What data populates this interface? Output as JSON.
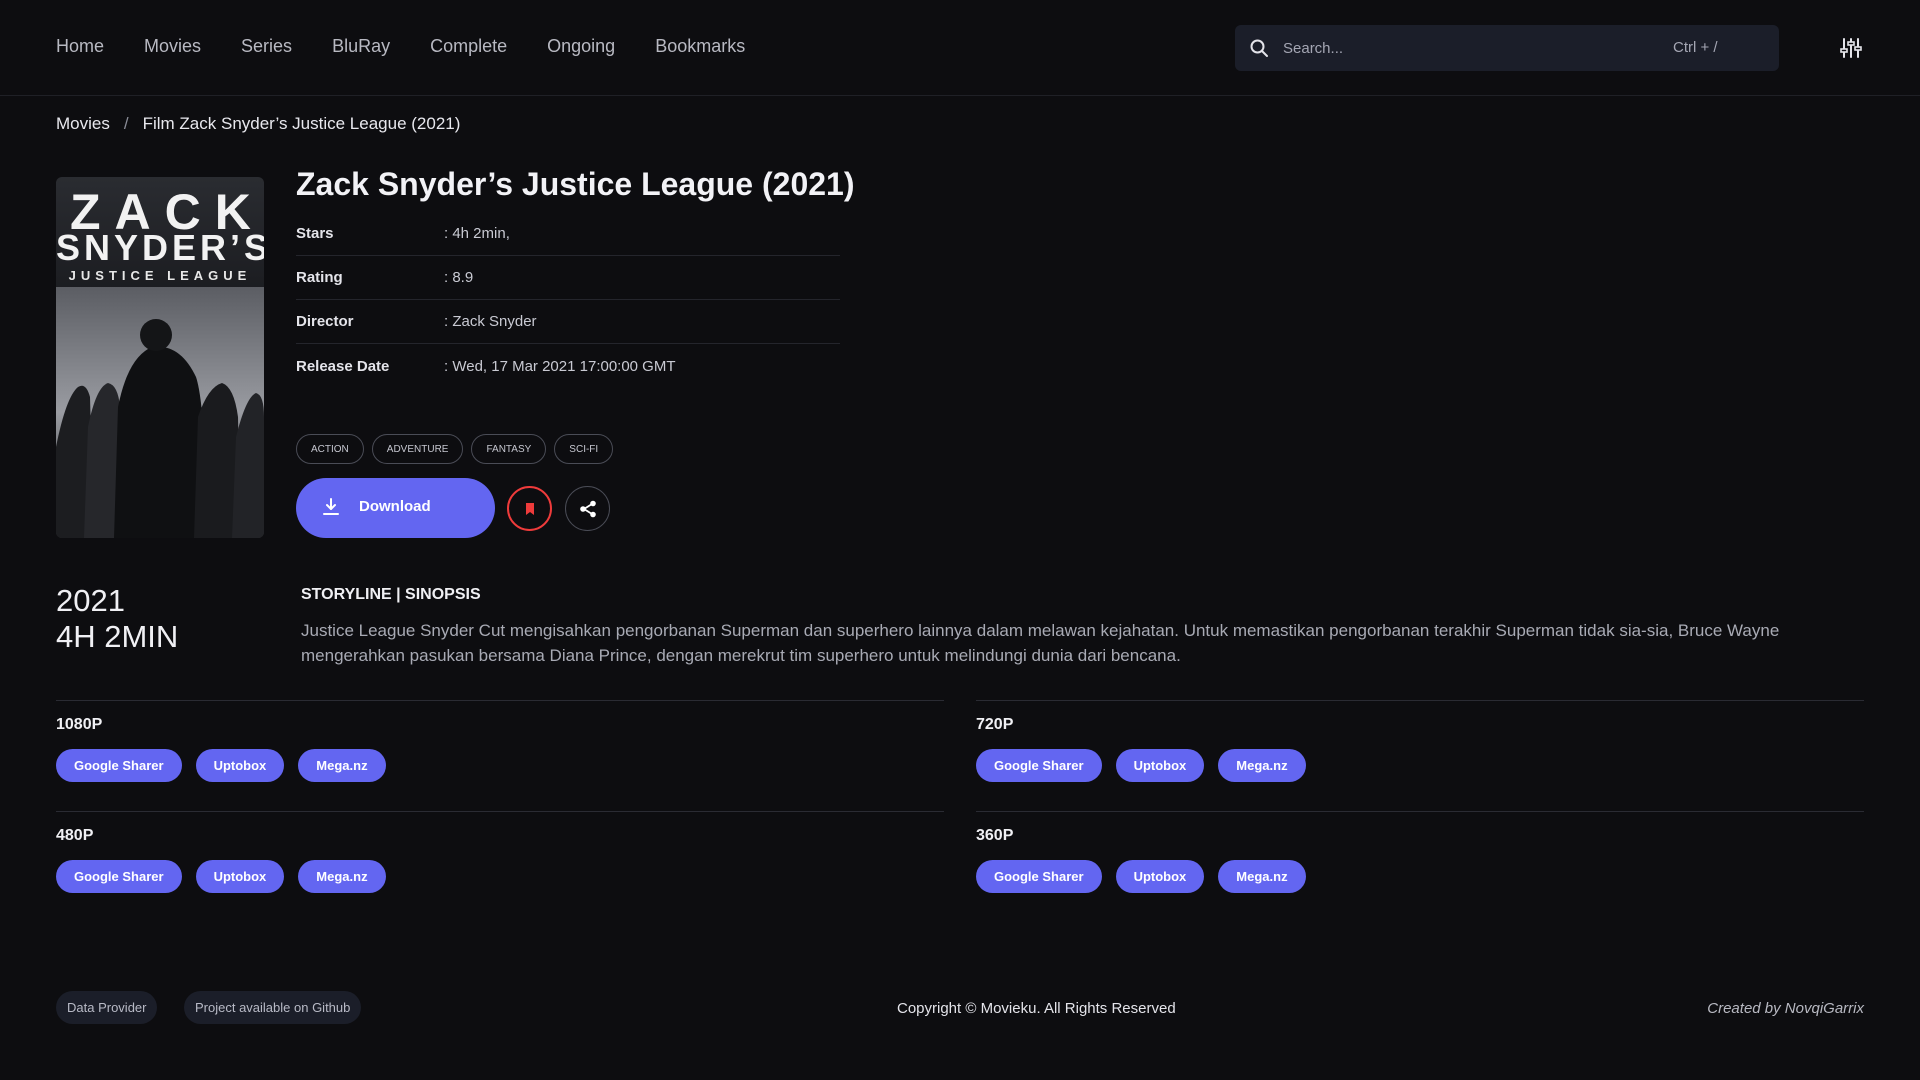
{
  "nav": {
    "items": [
      "Home",
      "Movies",
      "Series",
      "BluRay",
      "Complete",
      "Ongoing",
      "Bookmarks"
    ]
  },
  "search": {
    "placeholder": "Search...",
    "shortcut": "Ctrl + /",
    "icon": "search-icon"
  },
  "filter": {
    "icon": "sliders-icon"
  },
  "breadcrumb": {
    "items": [
      "Movies",
      "Film Zack Snyder’s Justice League (2021)"
    ],
    "separator": "/"
  },
  "poster": {
    "line1": "ZACK",
    "line2": "SNYDER’S",
    "line3": "JUSTICE LEAGUE"
  },
  "movie": {
    "title": "Zack Snyder’s Justice League (2021)",
    "info": [
      {
        "label": "Stars",
        "value": ": 4h 2min,"
      },
      {
        "label": "Rating",
        "value": ": 8.9"
      },
      {
        "label": "Director",
        "value": ": Zack Snyder"
      },
      {
        "label": "Release Date",
        "value": ": Wed, 17 Mar 2021 17:00:00 GMT"
      }
    ],
    "genres": [
      "ACTION",
      "ADVENTURE",
      "FANTASY",
      "SCI-FI"
    ],
    "download_label": "Download",
    "year": "2021",
    "duration": "4H 2MIN"
  },
  "storyline": {
    "heading": "STORYLINE | SINOPSIS",
    "text": "Justice League Snyder Cut mengisahkan pengorbanan Superman dan superhero lainnya dalam melawan kejahatan. Untuk memastikan pengorbanan terakhir Superman tidak sia-sia, Bruce Wayne mengerahkan pasukan bersama Diana Prince, dengan merekrut tim superhero untuk melindungi dunia dari bencana."
  },
  "qualities": [
    {
      "label": "1080P",
      "links": [
        "Google Sharer",
        "Uptobox",
        "Mega.nz"
      ]
    },
    {
      "label": "720P",
      "links": [
        "Google Sharer",
        "Uptobox",
        "Mega.nz"
      ]
    },
    {
      "label": "480P",
      "links": [
        "Google Sharer",
        "Uptobox",
        "Mega.nz"
      ]
    },
    {
      "label": "360P",
      "links": [
        "Google Sharer",
        "Uptobox",
        "Mega.nz"
      ]
    }
  ],
  "footer": {
    "data_provider": "Data Provider",
    "github": "Project available on Github",
    "copyright": "Copyright © Movieku. All Rights Reserved",
    "created_by": "Created by NovqiGarrix"
  },
  "colors": {
    "background": "#0d0d10",
    "accent": "#6366f1",
    "bookmark": "#ef3b3b",
    "panel": "#1b1e29"
  }
}
